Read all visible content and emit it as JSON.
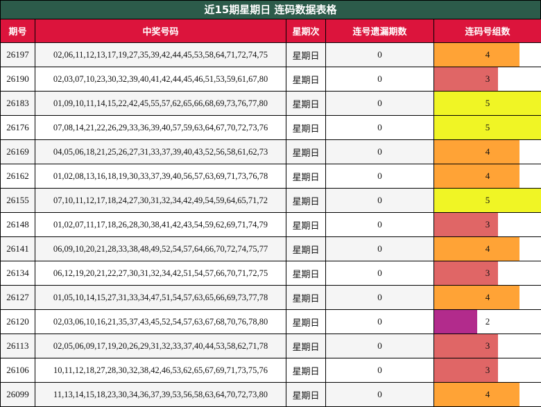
{
  "title": "近15期星期日 连码数据表格",
  "headers": [
    "期号",
    "中奖号码",
    "星期次",
    "连号遗漏期数",
    "连码号组数"
  ],
  "max_groups": 5,
  "colors": {
    "2": "#b22b8c",
    "3": "#e06666",
    "4": "#ffa336",
    "5": "#f0f525"
  },
  "rows": [
    {
      "issue": "26197",
      "numbers": "02,06,11,12,13,17,19,27,35,39,42,44,45,53,58,64,71,72,74,75",
      "day": "星期日",
      "miss": "0",
      "groups": 4
    },
    {
      "issue": "26190",
      "numbers": "02,03,07,10,23,30,32,39,40,41,42,44,45,46,51,53,59,61,67,80",
      "day": "星期日",
      "miss": "0",
      "groups": 3
    },
    {
      "issue": "26183",
      "numbers": "01,09,10,11,14,15,22,42,45,55,57,62,65,66,68,69,73,76,77,80",
      "day": "星期日",
      "miss": "0",
      "groups": 5
    },
    {
      "issue": "26176",
      "numbers": "07,08,14,21,22,26,29,33,36,39,40,57,59,63,64,67,70,72,73,76",
      "day": "星期日",
      "miss": "0",
      "groups": 5
    },
    {
      "issue": "26169",
      "numbers": "04,05,06,18,21,25,26,27,31,33,37,39,40,43,52,56,58,61,62,73",
      "day": "星期日",
      "miss": "0",
      "groups": 4
    },
    {
      "issue": "26162",
      "numbers": "01,02,08,13,16,18,19,30,33,37,39,40,56,57,63,69,71,73,76,78",
      "day": "星期日",
      "miss": "0",
      "groups": 4
    },
    {
      "issue": "26155",
      "numbers": "07,10,11,12,17,18,24,27,30,31,32,34,42,49,54,59,64,65,71,72",
      "day": "星期日",
      "miss": "0",
      "groups": 5
    },
    {
      "issue": "26148",
      "numbers": "01,02,07,11,17,18,26,28,30,38,41,42,43,54,59,62,69,71,74,79",
      "day": "星期日",
      "miss": "0",
      "groups": 3
    },
    {
      "issue": "26141",
      "numbers": "06,09,10,20,21,28,33,38,48,49,52,54,57,64,66,70,72,74,75,77",
      "day": "星期日",
      "miss": "0",
      "groups": 4
    },
    {
      "issue": "26134",
      "numbers": "06,12,19,20,21,22,27,30,31,32,34,42,51,54,57,66,70,71,72,75",
      "day": "星期日",
      "miss": "0",
      "groups": 3
    },
    {
      "issue": "26127",
      "numbers": "01,05,10,14,15,27,31,33,34,47,51,54,57,63,65,66,69,73,77,78",
      "day": "星期日",
      "miss": "0",
      "groups": 4
    },
    {
      "issue": "26120",
      "numbers": "02,03,06,10,16,21,35,37,43,45,52,54,57,63,67,68,70,76,78,80",
      "day": "星期日",
      "miss": "0",
      "groups": 2
    },
    {
      "issue": "26113",
      "numbers": "02,05,06,09,17,19,20,26,29,31,32,33,37,40,44,53,58,62,71,78",
      "day": "星期日",
      "miss": "0",
      "groups": 3
    },
    {
      "issue": "26106",
      "numbers": "10,11,12,18,27,28,30,32,38,42,46,53,62,65,67,69,71,73,75,76",
      "day": "星期日",
      "miss": "0",
      "groups": 3
    },
    {
      "issue": "26099",
      "numbers": "11,13,14,15,18,23,30,34,36,37,39,53,56,58,63,64,70,72,73,80",
      "day": "星期日",
      "miss": "0",
      "groups": 4
    }
  ]
}
